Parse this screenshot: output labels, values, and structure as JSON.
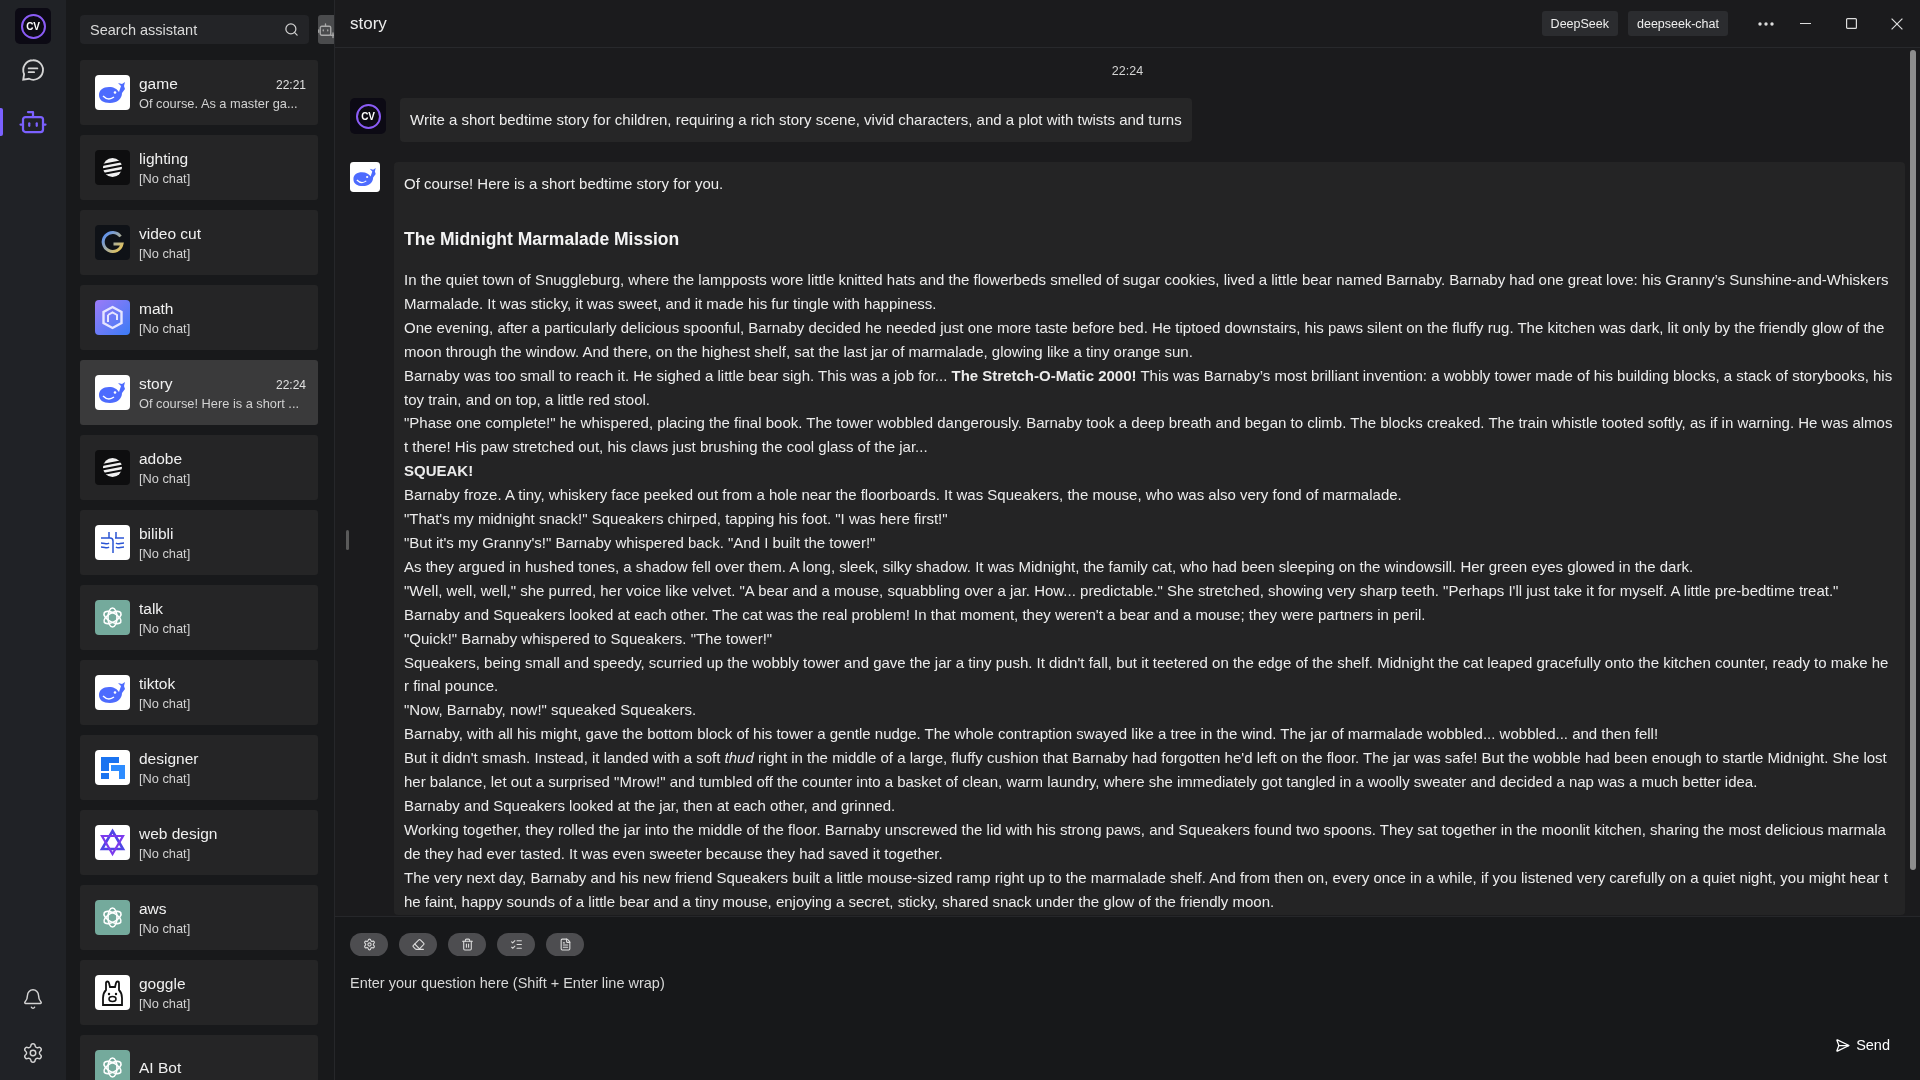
{
  "rail": {
    "logo": "CV",
    "nav": [
      {
        "kind": "chat",
        "selected": false
      },
      {
        "kind": "bot",
        "selected": true
      }
    ]
  },
  "sidebar": {
    "search": {
      "placeholder": "Search assistant"
    },
    "assistants": [
      {
        "kind": "whale",
        "name": "game",
        "time": "22:21",
        "preview": "Of course. As a master ga...",
        "selected": false
      },
      {
        "kind": "stripes",
        "name": "lighting",
        "preview": "[No chat]",
        "selected": false
      },
      {
        "kind": "arc",
        "name": "video cut",
        "preview": "[No chat]",
        "selected": false
      },
      {
        "kind": "hexagon",
        "name": "math",
        "preview": "[No chat]",
        "selected": false
      },
      {
        "kind": "whale",
        "name": "story",
        "time": "22:24",
        "preview": "Of course! Here is a short ...",
        "selected": true
      },
      {
        "kind": "stripes",
        "name": "adobe",
        "preview": "[No chat]",
        "selected": false
      },
      {
        "kind": "waves",
        "name": "bilibli",
        "preview": "[No chat]",
        "selected": false
      },
      {
        "kind": "knot",
        "name": "talk",
        "preview": "[No chat]",
        "selected": false
      },
      {
        "kind": "whale",
        "name": "tiktok",
        "preview": "[No chat]",
        "selected": false
      },
      {
        "kind": "steps",
        "name": "designer",
        "preview": "[No chat]",
        "selected": false
      },
      {
        "kind": "triangles",
        "name": "web design",
        "preview": "[No chat]",
        "selected": false
      },
      {
        "kind": "knot",
        "name": "aws",
        "preview": "[No chat]",
        "selected": false
      },
      {
        "kind": "llama",
        "name": "goggle",
        "preview": "[No chat]",
        "selected": false
      },
      {
        "kind": "knot",
        "name": "AI Bot",
        "selected": false
      }
    ]
  },
  "header": {
    "title": "story",
    "tags": [
      "DeepSeek",
      "deepseek-chat"
    ]
  },
  "chat": {
    "time": "22:24",
    "prompt": {
      "avatar": "CV",
      "text": "Write a short bedtime story for children, requiring a rich story scene, vivid characters, and a plot with twists and turns"
    },
    "reply": {
      "intro": "Of course! Here is a short bedtime story for you.",
      "title": "The Midnight Marmalade Mission",
      "paragraphs": [
        {
          "text": "In the quiet town of Snuggleburg, where the lampposts wore little knitted hats and the flowerbeds smelled of sugar cookies, lived a little bear named Barnaby. Barnaby had one great love: his Granny’s Sunshine-and-Whiskers Marmalade. It was sticky, it was sweet, and it made his fur tingle with happiness.",
          "bold": false
        },
        {
          "text": "One evening, after a particularly delicious spoonful, Barnaby decided he needed just one more taste before bed. He tiptoed downstairs, his paws silent on the fluffy rug. The kitchen was dark, lit only by the friendly glow of the moon through the window. And there, on the highest shelf, sat the last jar of marmalade, glowing like a tiny orange sun.",
          "bold": false
        },
        {
          "text": "Barnaby was too small to reach it. He sighed a little bear sigh. This was a job for... **The Stretch-O-Matic 2000!** This was Barnaby’s most brilliant invention: a wobbly tower made of his building blocks, a stack of storybooks, his toy train, and on top, a little red stool.",
          "bold": false
        },
        {
          "text": "\"Phase one complete!\" he whispered, placing the final book. The tower wobbled dangerously. Barnaby took a deep breath and began to climb. The blocks creaked. The train whistle tooted softly, as if in warning. He was almost there! His paw stretched out, his claws just brushing the cool glass of the jar...",
          "bold": false
        },
        {
          "text": "SQUEAK!",
          "bold": true
        },
        {
          "text": "Barnaby froze. A tiny, whiskery face peeked out from a hole near the floorboards. It was Squeakers, the mouse, who was also very fond of marmalade.",
          "bold": false
        },
        {
          "text": "\"That's my midnight snack!\" Squeakers chirped, tapping his foot. \"I was here first!\"",
          "bold": false
        },
        {
          "text": "\"But it's my Granny's!\" Barnaby whispered back. \"And I built the tower!\"",
          "bold": false
        },
        {
          "text": "As they argued in hushed tones, a shadow fell over them. A long, sleek, silky shadow. It was Midnight, the family cat, who had been sleeping on the windowsill. Her green eyes glowed in the dark.",
          "bold": false
        },
        {
          "text": "\"Well, well, well,\" she purred, her voice like velvet. \"A bear and a mouse, squabbling over a jar. How... predictable.\" She stretched, showing very sharp teeth. \"Perhaps I'll just take it for myself. A little pre-bedtime treat.\"",
          "bold": false
        },
        {
          "text": "Barnaby and Squeakers looked at each other. The cat was the real problem! In that moment, they weren't a bear and a mouse; they were partners in peril.",
          "bold": false
        },
        {
          "text": "\"Quick!\" Barnaby whispered to Squeakers. \"The tower!\"",
          "bold": false
        },
        {
          "text": "Squeakers, being small and speedy, scurried up the wobbly tower and gave the jar a tiny push. It didn't fall, but it teetered on the edge of the shelf. Midnight the cat leaped gracefully onto the kitchen counter, ready to make her final pounce.",
          "bold": false
        },
        {
          "text": "\"Now, Barnaby, now!\" squeaked Squeakers.",
          "bold": false
        },
        {
          "text": "Barnaby, with all his might, gave the bottom block of his tower a gentle nudge. The whole contraption swayed like a tree in the wind. The jar of marmalade wobbled... wobbled... and then fell!",
          "bold": false
        },
        {
          "text": "But it didn't smash. Instead, it landed with a soft *thud* right in the middle of a large, fluffy cushion that Barnaby had forgotten he'd left on the floor. The jar was safe! But the wobble had been enough to startle Midnight. She lost her balance, let out a surprised \"Mrow!\" and tumbled off the counter into a basket of clean, warm laundry, where she immediately got tangled in a woolly sweater and decided a nap was a much better idea.",
          "bold": false
        },
        {
          "text": "Barnaby and Squeakers looked at the jar, then at each other, and grinned.",
          "bold": false
        },
        {
          "text": "Working together, they rolled the jar into the middle of the floor. Barnaby unscrewed the lid with his strong paws, and Squeakers found two spoons. They sat together in the moonlit kitchen, sharing the most delicious marmalade they had ever tasted. It was even sweeter because they had saved it together.",
          "bold": false
        },
        {
          "text": "The very next day, Barnaby and his new friend Squeakers built a little mouse-sized ramp right up to the marmalade shelf. And from then on, every once in a while, if you listened very carefully on a quiet night, you might hear the faint, happy sounds of a little bear and a tiny mouse, enjoying a secret, sticky, shared snack under the glow of the friendly moon.",
          "bold": false
        }
      ]
    }
  },
  "composer": {
    "placeholder": "Enter your question here (Shift + Enter line wrap)",
    "send": "Send"
  }
}
